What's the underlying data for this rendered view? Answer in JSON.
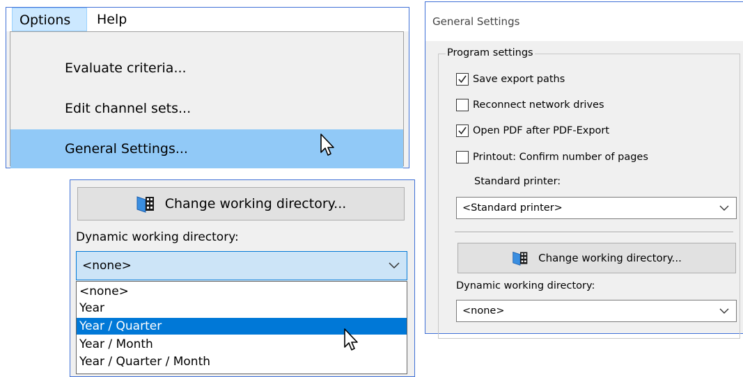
{
  "menu": {
    "menubar": [
      "Options",
      "Help"
    ],
    "items": [
      "Evaluate criteria...",
      "Edit channel sets...",
      "General Settings..."
    ],
    "highlighted_index": 2
  },
  "dir_dropdown": {
    "button_label": "Change working directory...",
    "combo_label": "Dynamic working directory:",
    "combo_value": "<none>",
    "options": [
      "<none>",
      "Year",
      "Year / Quarter",
      "Year / Month",
      "Year / Quarter / Month"
    ],
    "selected_index": 2
  },
  "settings": {
    "title": "General Settings",
    "group_title": "Program settings",
    "checkboxes": [
      {
        "label": "Save export paths",
        "checked": true
      },
      {
        "label": "Reconnect network drives",
        "checked": false
      },
      {
        "label": "Open PDF after PDF-Export",
        "checked": true
      },
      {
        "label": "Printout: Confirm number of pages",
        "checked": false
      }
    ],
    "printer_label": "Standard printer:",
    "printer_value": "<Standard printer>",
    "button_label": "Change working directory...",
    "combo_label": "Dynamic working directory:",
    "combo_value": "<none>"
  },
  "colors": {
    "accent_border": "#3e6fd6",
    "menu_highlight": "#91c9f7",
    "selection": "#0078d7"
  }
}
